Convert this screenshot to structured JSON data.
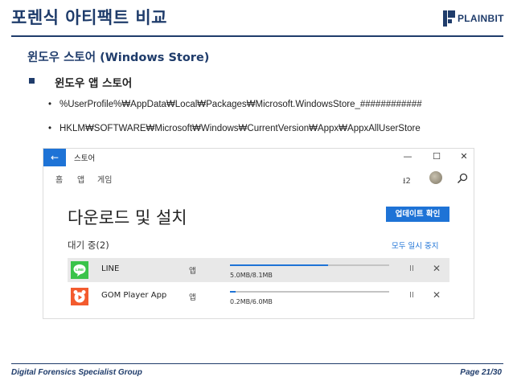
{
  "slide": {
    "title": "포렌식 아티팩트 비교",
    "logo_text": "PLAINBIT",
    "section_title": "윈도우 스토어 (Windows Store)",
    "bullet_l1": "윈도우 앱 스토어",
    "bullets_l2": [
      "%UserProfile%₩AppData₩Local₩Packages₩Microsoft.WindowsStore_############",
      "HKLM₩SOFTWARE₩Microsoft₩Windows₩CurrentVersion₩Appx₩AppxAllUserStore"
    ],
    "bullet_l2_marker": "•",
    "footer_left": "Digital Forensics Specialist Group",
    "footer_right": "Page 21/30"
  },
  "store": {
    "back_glyph": "←",
    "window_title": "스토어",
    "controls": {
      "minimize": "—",
      "maximize": "☐",
      "close": "✕"
    },
    "nav": [
      "홈",
      "앱",
      "게임"
    ],
    "download_count": "⭳2",
    "page_heading": "다운로드 및 설치",
    "update_button": "업데이트 확인",
    "queue_label": "대기 중(2)",
    "pause_all": "모두 일시 중지",
    "pause_glyph": "II",
    "cancel_glyph": "✕",
    "items": [
      {
        "name": "LINE",
        "type": "앱",
        "progress_fraction": 0.617,
        "size": "5.0MB/8.1MB",
        "icon": "line-app-icon",
        "icon_color": "#3ac34a",
        "selected": true
      },
      {
        "name": "GOM Player App",
        "type": "앱",
        "progress_fraction": 0.033,
        "size": "0.2MB/6.0MB",
        "icon": "gom-player-icon",
        "icon_color": "#f35b2e",
        "selected": false
      }
    ]
  },
  "colors": {
    "accent": "#1e73d6",
    "brand_navy": "#1f3c6b"
  }
}
